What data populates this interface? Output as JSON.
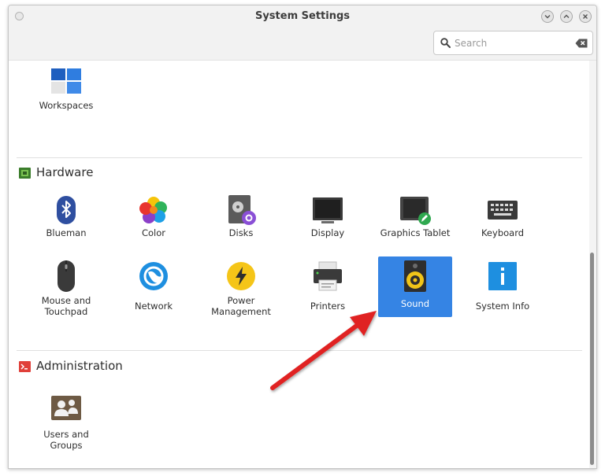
{
  "window": {
    "title": "System Settings"
  },
  "search": {
    "placeholder": "Search"
  },
  "personal_items": [
    {
      "label": "Workspaces",
      "icon": "workspaces-icon"
    }
  ],
  "hardware": {
    "title": "Hardware",
    "items": [
      {
        "label": "Blueman",
        "icon": "bluetooth-icon"
      },
      {
        "label": "Color",
        "icon": "color-icon"
      },
      {
        "label": "Disks",
        "icon": "disks-icon"
      },
      {
        "label": "Display",
        "icon": "display-icon"
      },
      {
        "label": "Graphics Tablet",
        "icon": "graphics-tablet-icon"
      },
      {
        "label": "Keyboard",
        "icon": "keyboard-icon"
      },
      {
        "label": "Mouse and\nTouchpad",
        "icon": "mouse-icon"
      },
      {
        "label": "Network",
        "icon": "network-icon"
      },
      {
        "label": "Power\nManagement",
        "icon": "power-icon"
      },
      {
        "label": "Printers",
        "icon": "printer-icon"
      },
      {
        "label": "Sound",
        "icon": "speaker-icon",
        "selected": true
      },
      {
        "label": "System Info",
        "icon": "info-icon"
      }
    ]
  },
  "administration": {
    "title": "Administration",
    "items": [
      {
        "label": "Users and\nGroups",
        "icon": "users-icon"
      }
    ]
  },
  "colors": {
    "selection": "#3584e4",
    "annotation_arrow": "#e02020"
  }
}
